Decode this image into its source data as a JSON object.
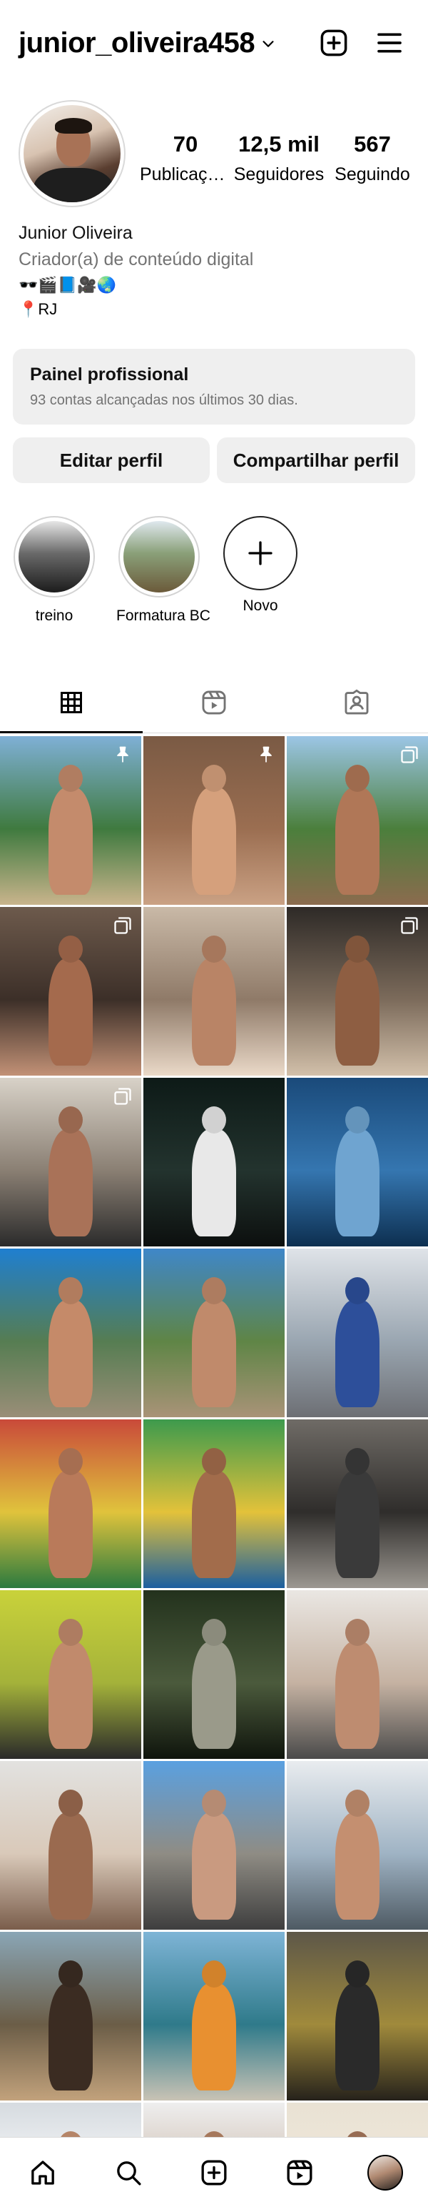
{
  "header": {
    "username": "junior_oliveira458",
    "icons": {
      "dropdown": "chevron-down-icon",
      "create": "plus-square-icon",
      "menu": "hamburger-menu-icon"
    }
  },
  "profile": {
    "stats": [
      {
        "value": "70",
        "label": "Publicaçõ..."
      },
      {
        "value": "12,5 mil",
        "label": "Seguidores"
      },
      {
        "value": "567",
        "label": "Seguindo"
      }
    ],
    "name": "Junior Oliveira",
    "category": "Criador(a) de conteúdo digital",
    "bio_emojis": "🕶️🎬📘🎥🌏",
    "location": "📍RJ"
  },
  "professional_panel": {
    "title": "Painel profissional",
    "subtitle": "93 contas alcançadas nos últimos 30 dias."
  },
  "buttons": {
    "edit": "Editar perfil",
    "share": "Compartilhar perfil"
  },
  "highlights": [
    {
      "label": "treino"
    },
    {
      "label": "Formatura BC"
    },
    {
      "label": "Novo"
    }
  ],
  "tabs": [
    {
      "icon": "grid-icon",
      "active": true
    },
    {
      "icon": "reels-icon",
      "active": false
    },
    {
      "icon": "tagged-icon",
      "active": false
    }
  ],
  "posts": [
    {
      "bg": [
        "#7fb0d6",
        "#3f7a3f",
        "#c9b48c"
      ],
      "fig": "#c48b6c",
      "mark": "pin-icon"
    },
    {
      "bg": [
        "#7a5a44",
        "#9b6e51",
        "#caa184"
      ],
      "fig": "#d5a07c",
      "mark": "pin-icon"
    },
    {
      "bg": [
        "#9cc6e6",
        "#4b7f3c",
        "#8b6b4e"
      ],
      "fig": "#b07757",
      "mark": "carousel-icon"
    },
    {
      "bg": [
        "#6d5a4c",
        "#3c2f28",
        "#c29176"
      ],
      "fig": "#a46a4d",
      "mark": "carousel-icon"
    },
    {
      "bg": [
        "#c9b9a7",
        "#8f7a68",
        "#ead9c8"
      ],
      "fig": "#b98466",
      "mark": ""
    },
    {
      "bg": [
        "#2e2a27",
        "#7c6b5b",
        "#d2c0aa"
      ],
      "fig": "#8e5e42",
      "mark": "carousel-icon"
    },
    {
      "bg": [
        "#d8d2c8",
        "#8a7f73",
        "#2b2b2b"
      ],
      "fig": "#a97258",
      "mark": "carousel-icon"
    },
    {
      "bg": [
        "#0d1a17",
        "#23332e",
        "#0c0f0e"
      ],
      "fig": "#e8e8e8",
      "mark": ""
    },
    {
      "bg": [
        "#1a4a7a",
        "#3576b0",
        "#0d2f50"
      ],
      "fig": "#6fa4d0",
      "mark": ""
    },
    {
      "bg": [
        "#1f7fd0",
        "#567d52",
        "#9a8e78"
      ],
      "fig": "#c58a69",
      "mark": ""
    },
    {
      "bg": [
        "#3f87c9",
        "#5f8546",
        "#a99378"
      ],
      "fig": "#c08a6b",
      "mark": ""
    },
    {
      "bg": [
        "#dfe3e8",
        "#9aa6b1",
        "#6d6f74"
      ],
      "fig": "#2d4f9a",
      "mark": ""
    },
    {
      "bg": [
        "#c94a3a",
        "#e0c33c",
        "#2b7a3f"
      ],
      "fig": "#b97a5a",
      "mark": ""
    },
    {
      "bg": [
        "#3d9a4d",
        "#e3c23a",
        "#1b5fa0"
      ],
      "fig": "#a26c4b",
      "mark": ""
    },
    {
      "bg": [
        "#6f6b66",
        "#2f2d2b",
        "#9c9791"
      ],
      "fig": "#3a3a3a",
      "mark": ""
    },
    {
      "bg": [
        "#c9d23a",
        "#a4b23a",
        "#2a2a2a"
      ],
      "fig": "#c18a6c",
      "mark": ""
    },
    {
      "bg": [
        "#23321d",
        "#4b5a3c",
        "#0f140c"
      ],
      "fig": "#9a9a8a",
      "mark": ""
    },
    {
      "bg": [
        "#eae7e3",
        "#c5b2a2",
        "#4a4a4a"
      ],
      "fig": "#be8c70",
      "mark": ""
    },
    {
      "bg": [
        "#e2e2e0",
        "#d9c9b9",
        "#7a5d4b"
      ],
      "fig": "#9a6a4f",
      "mark": ""
    },
    {
      "bg": [
        "#5aa0e0",
        "#8f8c84",
        "#3e3e3e"
      ],
      "fig": "#c99a80",
      "mark": ""
    },
    {
      "bg": [
        "#e9ecef",
        "#9fb3c4",
        "#4e5a63"
      ],
      "fig": "#c48f70",
      "mark": ""
    },
    {
      "bg": [
        "#8aa6b6",
        "#6b5d47",
        "#c2a27c"
      ],
      "fig": "#3b2c22",
      "mark": ""
    },
    {
      "bg": [
        "#7eb4d6",
        "#2f7a8a",
        "#c9c3b5"
      ],
      "fig": "#e89030",
      "mark": ""
    },
    {
      "bg": [
        "#5d5748",
        "#a08a3c",
        "#26221b"
      ],
      "fig": "#2a2a2a",
      "mark": ""
    },
    {
      "bg": [
        "#d6dbe0",
        "#ffffff",
        "#a8a8a8"
      ],
      "fig": "#c99474",
      "mark": ""
    },
    {
      "bg": [
        "#eeeeee",
        "#c8b4a4",
        "#3a3a3a"
      ],
      "fig": "#b98566",
      "mark": ""
    },
    {
      "bg": [
        "#e9e2d4",
        "#f1e8da",
        "#b7a894"
      ],
      "fig": "#a8785c",
      "mark": ""
    }
  ],
  "bottom_nav": [
    {
      "icon": "home-icon"
    },
    {
      "icon": "search-icon"
    },
    {
      "icon": "create-icon"
    },
    {
      "icon": "reels-icon"
    },
    {
      "icon": "profile-avatar"
    }
  ]
}
